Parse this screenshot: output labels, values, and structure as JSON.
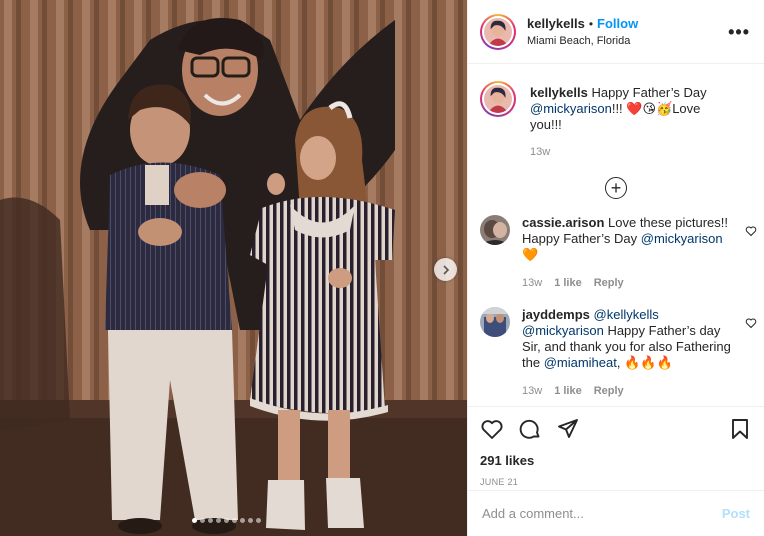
{
  "post": {
    "author": {
      "username": "kellykells",
      "separator": "•",
      "follow_label": "Follow",
      "location": "Miami Beach, Florida"
    },
    "more_label": "•••",
    "photo": {
      "slides_total": 9,
      "slide_index": 0,
      "next_icon": "chevron-right-icon"
    },
    "caption": {
      "username": "kellykells",
      "text_a": "Happy Father’s Day",
      "mention": "@mickyarison",
      "text_b": "!!! ❤️😘🥳Love you!!!",
      "time": "13w"
    },
    "load_more_icon": "plus-circle-icon",
    "comments": [
      {
        "username": "cassie.arison",
        "text_a": "Love these pictures!! Happy Father’s Day",
        "mention_a": "@mickyarison",
        "text_b": " 🧡",
        "mention_b": "",
        "text_c": "",
        "time": "13w",
        "likes": "1 like",
        "reply": "Reply"
      },
      {
        "username": "jayddemps",
        "text_a": "",
        "mention_a": "@kellykells",
        "text_b": "",
        "mention_b": "@mickyarison",
        "text_c": " Happy Father’s day Sir, and thank you for also Fathering the ",
        "mention_c": "@miamiheat",
        "text_d": ", 🔥🔥🔥",
        "time": "13w",
        "likes": "1 like",
        "reply": "Reply"
      }
    ],
    "actions": {
      "like_icon": "heart-icon",
      "comment_icon": "comment-icon",
      "share_icon": "send-icon",
      "save_icon": "bookmark-icon"
    },
    "likes_label": "291 likes",
    "date_label": "JUNE 21",
    "add_comment": {
      "placeholder": "Add a comment...",
      "post_label": "Post"
    },
    "colors": {
      "accent": "#0095f6",
      "mention": "#00376b",
      "muted": "#8e8e8e",
      "post_disabled": "#b2dffc"
    }
  }
}
